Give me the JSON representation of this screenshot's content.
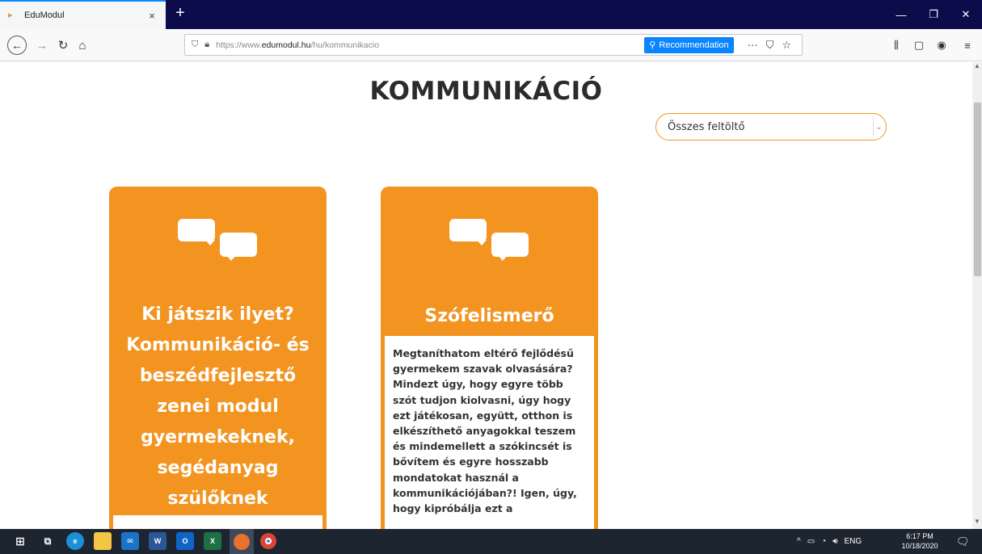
{
  "browser": {
    "tab_title": "EduModul",
    "tab_close": "×",
    "new_tab": "+",
    "url_prefix": "https://www.",
    "url_domain": "edumodul.hu",
    "url_path": "/hu/kommunikacio",
    "recommendation_label": "Recommendation",
    "more_label": "···"
  },
  "page": {
    "title": "KOMMUNIKÁCIÓ",
    "filter": {
      "selected": "Összes feltöltő"
    }
  },
  "cards": [
    {
      "title": "Ki játszik ilyet? Kommunikáció- és beszédfejlesztő zenei modul gyermekeknek, segédanyag szülőknek",
      "body": ""
    },
    {
      "title": "Szófelismerő",
      "body": "Megtaníthatom eltérő fejlődésű gyermekem szavak olvasására? Mindezt úgy, hogy egyre több szót tudjon kiolvasni, úgy hogy ezt játékosan, együtt, otthon is elkészíthető anyagokkal teszem és mindemellett a szókincsét is bővítem és egyre hosszabb mondatokat használ a kommunikációjában?! Igen, úgy, hogy kipróbálja ezt a"
    }
  ],
  "taskbar": {
    "lang": "ENG",
    "time": "6:17 PM",
    "date": "10/18/2020"
  },
  "colors": {
    "accent": "#f39421",
    "title": "#2b2b2b",
    "tabstrip": "#0c0c4a",
    "taskbar": "#1c2530"
  }
}
